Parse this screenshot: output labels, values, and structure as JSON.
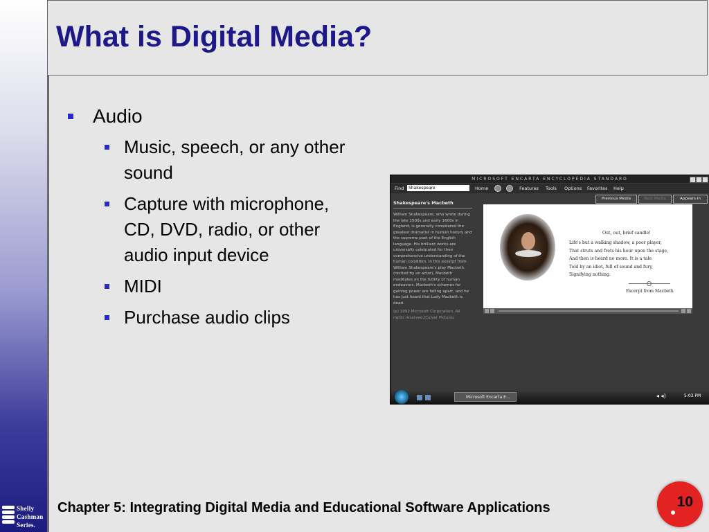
{
  "slide": {
    "title": "What is Digital Media?",
    "bullet_main": "Audio",
    "sub_bullets": [
      "Music, speech, or any other sound",
      "Capture with microphone, CD, DVD, radio, or other audio input device",
      "MIDI",
      "Purchase audio clips"
    ],
    "footer": "Chapter 5: Integrating Digital Media and Educational Software Applications",
    "page_number": "10",
    "logo_lines": [
      "Shelly",
      "Cashman",
      "Series."
    ],
    "colors": {
      "title": "#1e1888",
      "bullet": "#2a2ac8",
      "page_circle": "#e32222"
    }
  },
  "screenshot": {
    "window_title": "MICROSOFT ENCARTA ENCYCLOPEDIA STANDARD",
    "menu": {
      "find_label": "Find",
      "find_value": "Shakespeare",
      "home": "Home",
      "features": "Features",
      "tools": "Tools",
      "options": "Options",
      "favorites": "Favorites",
      "help": "Help"
    },
    "tabs": {
      "previous": "Previous Media",
      "next": "Next Media",
      "appears_in": "Appears In"
    },
    "article_title": "Shakespeare's Macbeth",
    "article_body": "William Shakespeare, who wrote during the late 1500s and early 1600s in England, is generally considered the greatest dramatist in human history and the supreme poet of the English language. His brilliant works are universally celebrated for their comprehensive understanding of the human condition. In this excerpt from William Shakespeare's play Macbeth (recited by an actor), Macbeth meditates on the futility of human endeavors. Macbeth's schemes for gaining power are falling apart, and he has just heard that Lady Macbeth is dead.",
    "article_copyright": "(p) 1992 Microsoft Corporation. All rights reserved./Culver Pictures",
    "poem_title": "Out, out, brief candle!",
    "poem_lines": [
      "Life's but a walking shadow, a poor player,",
      "That struts and frets his hour upon the stage,",
      "And then is heard no more. It is a tale",
      "Told by an idiot, full of sound and fury,",
      "Signifying nothing."
    ],
    "excerpt_label": "Excerpt from Macbeth",
    "taskbar_item": "Microsoft Encarta E...",
    "clock": "5:03 PM"
  }
}
